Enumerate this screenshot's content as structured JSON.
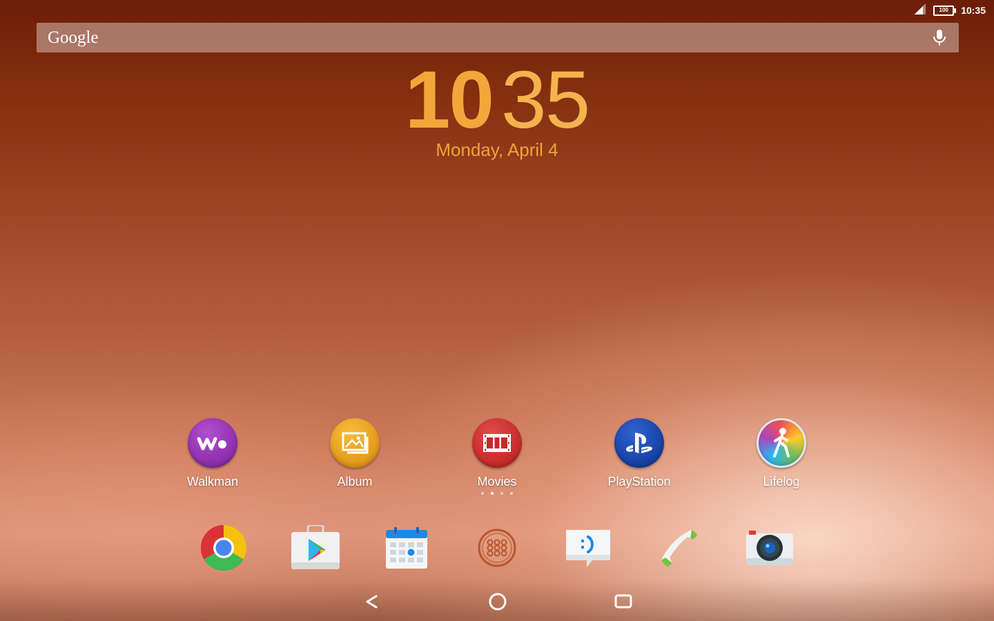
{
  "status_bar": {
    "time": "10:35",
    "battery_level": "100"
  },
  "search": {
    "logo_text": "Google"
  },
  "clock": {
    "hour": "10",
    "minute": "35",
    "date": "Monday, April 4"
  },
  "apps": [
    {
      "label": "Walkman",
      "icon": "walkman-icon",
      "color": "#8e24aa"
    },
    {
      "label": "Album",
      "icon": "album-icon",
      "color": "#e89a16"
    },
    {
      "label": "Movies",
      "icon": "movies-icon",
      "color": "#c62828"
    },
    {
      "label": "PlayStation",
      "icon": "playstation-icon",
      "color": "#1a3fa8"
    },
    {
      "label": "Lifelog",
      "icon": "lifelog-icon",
      "color": "#b0bec5"
    }
  ],
  "home_pages": {
    "count": 4,
    "current": 2
  },
  "dock": [
    {
      "icon": "chrome-icon"
    },
    {
      "icon": "play-store-icon"
    },
    {
      "icon": "calendar-icon"
    },
    {
      "icon": "app-drawer-icon"
    },
    {
      "icon": "messaging-icon"
    },
    {
      "icon": "phone-icon"
    },
    {
      "icon": "camera-icon"
    }
  ],
  "navigation": [
    "back-icon",
    "home-icon",
    "recents-icon"
  ]
}
